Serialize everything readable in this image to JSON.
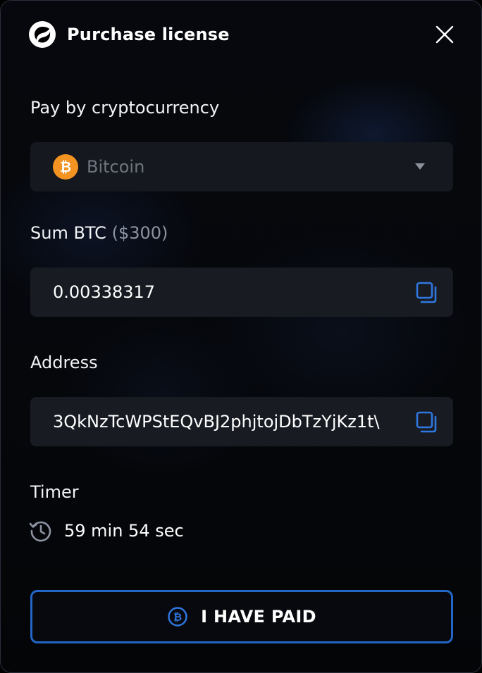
{
  "window": {
    "title": "Purchase license"
  },
  "payment": {
    "section_label": "Pay by cryptocurrency",
    "currency": {
      "selected": "Bitcoin",
      "icon": "bitcoin-coin-icon",
      "symbol": "₿"
    }
  },
  "sum": {
    "label": "Sum BTC",
    "usd": "($300)",
    "value": "0.00338317"
  },
  "address": {
    "label": "Address",
    "value": "3QkNzTcWPStEQvBJ2phjtojDbTzYjKz1t\\"
  },
  "timer": {
    "label": "Timer",
    "value": "59 min 54 sec"
  },
  "actions": {
    "paid_label": "I HAVE PAID"
  },
  "colors": {
    "accent": "#2366c6",
    "bitcoin": "#f39321",
    "background": "#05070b",
    "field": "#181b22"
  }
}
